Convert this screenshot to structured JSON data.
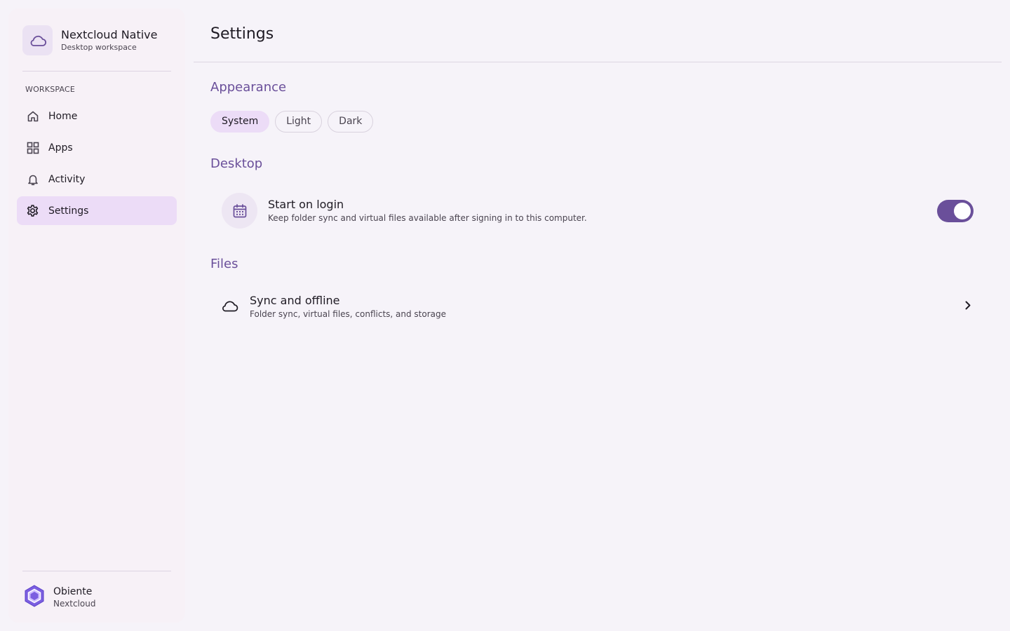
{
  "sidebar": {
    "brand_name": "Nextcloud Native",
    "brand_subtitle": "Desktop workspace",
    "brand_icon": "cloud-icon",
    "section_label": "WORKSPACE",
    "items": [
      {
        "label": "Home",
        "icon": "home-icon",
        "active": false
      },
      {
        "label": "Apps",
        "icon": "grid-icon",
        "active": false
      },
      {
        "label": "Activity",
        "icon": "bell-icon",
        "active": false
      },
      {
        "label": "Settings",
        "icon": "gear-icon",
        "active": true
      }
    ],
    "account": {
      "name": "Obiente",
      "subtitle": "Nextcloud",
      "icon": "hexagon-logo-icon"
    }
  },
  "main": {
    "title": "Settings",
    "appearance": {
      "title": "Appearance",
      "options": [
        "System",
        "Light",
        "Dark"
      ],
      "selected": "System"
    },
    "desktop": {
      "title": "Desktop",
      "start_on_login": {
        "title": "Start on login",
        "description": "Keep folder sync and virtual files available after signing in to this computer.",
        "icon": "calendar-icon",
        "enabled": true
      }
    },
    "files": {
      "title": "Files",
      "sync": {
        "title": "Sync and offline",
        "description": "Folder sync, virtual files, conflicts, and storage",
        "icon": "cloud-icon"
      }
    }
  },
  "colors": {
    "accent": "#6a4f9a",
    "active_bg": "#ecdcf7",
    "background": "#f6f3f9"
  }
}
